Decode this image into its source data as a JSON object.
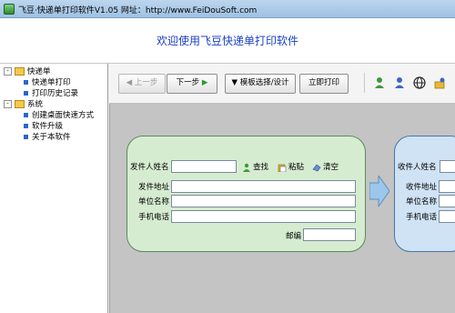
{
  "window": {
    "title": "飞豆·快递单打印软件V1.05   网址：http://www.FeiDouSoft.com",
    "buttons": {
      "minimize": "–",
      "maximize": "□",
      "close": "✕"
    }
  },
  "banner": {
    "welcome": "欢迎使用飞豆快递单打印软件"
  },
  "tree": {
    "groups": [
      {
        "label": "快递单",
        "expanded": "-",
        "items": [
          "快递单打印",
          "打印历史记录"
        ]
      },
      {
        "label": "系统",
        "expanded": "-",
        "items": [
          "创建桌面快速方式",
          "软件升级",
          "关于本软件"
        ]
      }
    ]
  },
  "toolbar": {
    "prev": "上一步",
    "next": "下一步",
    "template": "模板选择/设计",
    "print": "立即打印"
  },
  "sender": {
    "name_label": "发件人姓名",
    "find": "查找",
    "paste": "粘贴",
    "clear": "清空",
    "address_label": "发件地址",
    "company_label": "单位名称",
    "phone_label": "手机电话",
    "postcode_label": "邮编",
    "values": {
      "name": "",
      "address": "",
      "company": "",
      "phone": "",
      "postcode": ""
    }
  },
  "receiver": {
    "name_label": "收件人姓名",
    "address_label": "收件地址",
    "company_label": "单位名称",
    "phone_label": "手机电话"
  },
  "icons": {
    "toolbar": [
      "user-green-icon",
      "user-blue-icon",
      "globe-icon",
      "user-folder-icon"
    ]
  },
  "colors": {
    "welcome": "#1a3fc8",
    "sender_panel": "#d6ecd1",
    "receiver_panel": "#cfe3f5",
    "workarea": "#c4c4c4"
  }
}
